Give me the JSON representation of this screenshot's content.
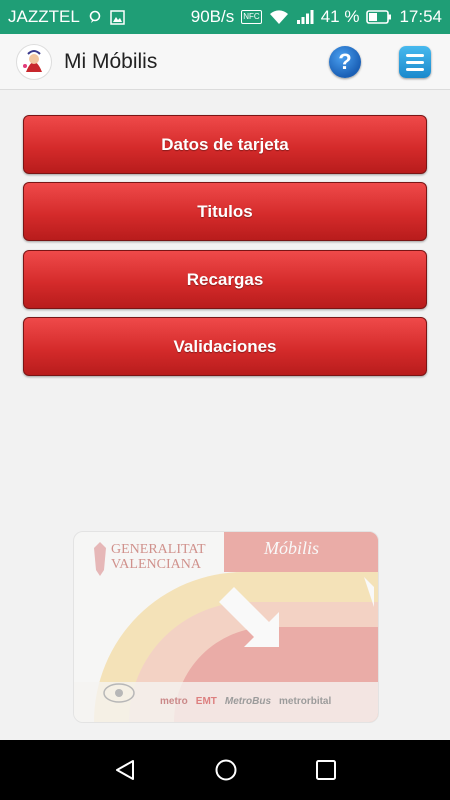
{
  "status_bar": {
    "carrier": "JAZZTEL",
    "speed": "90B/s",
    "nfc": "NFC",
    "battery": "41 %",
    "time": "17:54"
  },
  "app_bar": {
    "title": "Mi Móbilis",
    "help_label": "?"
  },
  "menu": {
    "items": [
      {
        "label": "Datos de tarjeta"
      },
      {
        "label": "Titulos"
      },
      {
        "label": "Recargas"
      },
      {
        "label": "Validaciones"
      }
    ]
  },
  "card": {
    "issuer_line1": "GENERALITAT",
    "issuer_line2": "VALENCIANA",
    "brand": "Móbilis",
    "logos": [
      "metro",
      "EMT",
      "MetroBus",
      "metrorbital"
    ]
  },
  "colors": {
    "status_bar": "#1f9e76",
    "button_red": "#d52b2b",
    "help_blue": "#1a5fb5",
    "menu_blue": "#1a89cc"
  },
  "icons": {
    "help": "help-icon",
    "menu": "hamburger-menu-icon",
    "back": "back-triangle-icon",
    "home": "home-circle-icon",
    "recents": "recents-square-icon"
  }
}
